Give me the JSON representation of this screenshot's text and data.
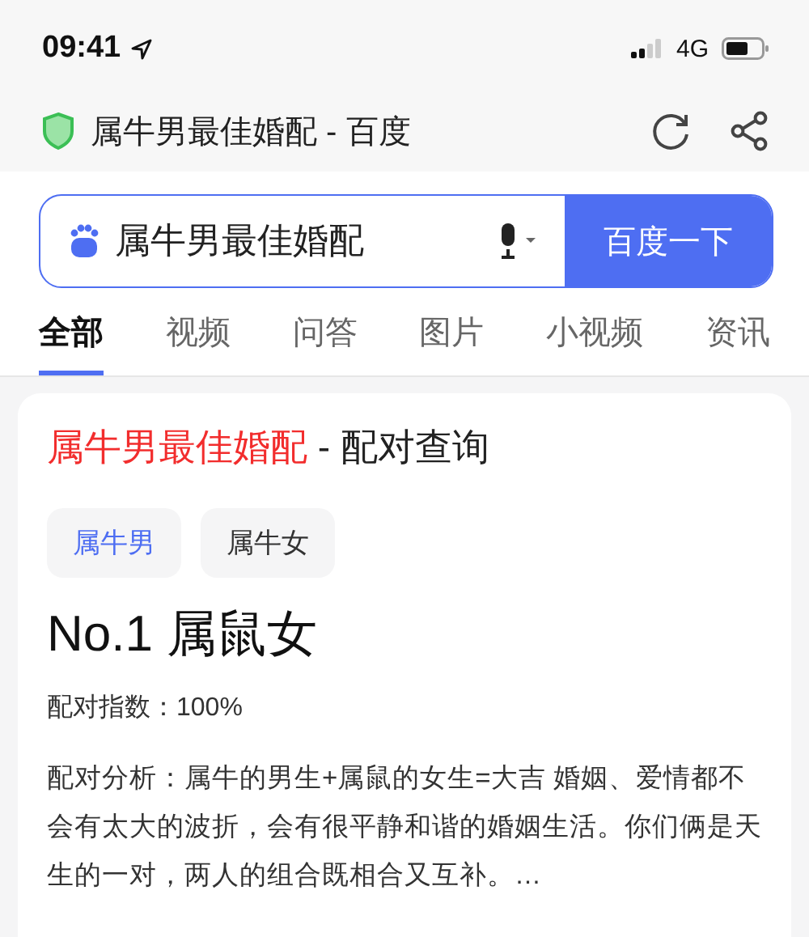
{
  "status_bar": {
    "time": "09:41",
    "network": "4G"
  },
  "address_bar": {
    "title": "属牛男最佳婚配 - 百度"
  },
  "search": {
    "value": "属牛男最佳婚配",
    "button": "百度一下"
  },
  "tabs": [
    {
      "label": "全部",
      "selected": true
    },
    {
      "label": "视频",
      "selected": false
    },
    {
      "label": "问答",
      "selected": false
    },
    {
      "label": "图片",
      "selected": false
    },
    {
      "label": "小视频",
      "selected": false
    },
    {
      "label": "资讯",
      "selected": false
    }
  ],
  "result": {
    "title_highlight": "属牛男最佳婚配",
    "title_rest": " - 配对查询",
    "tags": [
      {
        "label": "属牛男",
        "selected": true
      },
      {
        "label": "属牛女",
        "selected": false
      }
    ],
    "headline": "No.1 属鼠女",
    "score": "配对指数：100%",
    "analysis": "配对分析：属牛的男生+属鼠的女生=大吉 婚姻、爱情都不会有太大的波折，会有很平静和谐的婚姻生活。你们俩是天生的一对，两人的组合既相合又互补。…"
  }
}
